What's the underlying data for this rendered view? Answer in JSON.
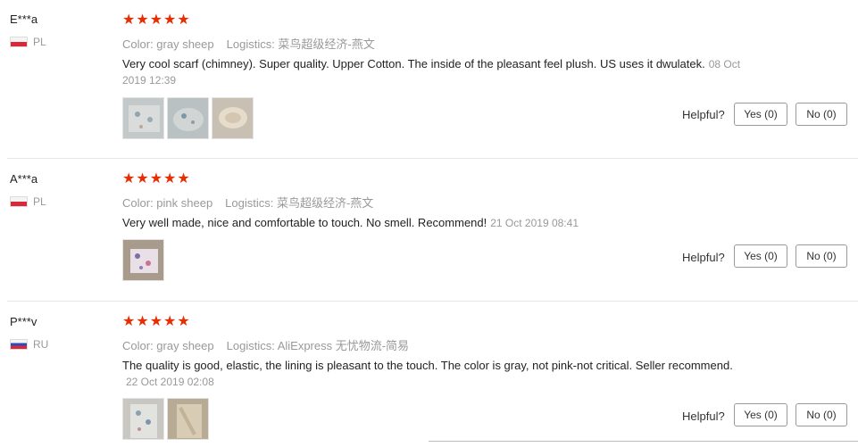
{
  "star_glyph": "★",
  "helpful_label": "Helpful?",
  "reviews": [
    {
      "user": "E***a",
      "country": "PL",
      "color": "Color: gray sheep",
      "logistics": "Logistics: 菜鸟超级经济-燕文",
      "text": "Very cool scarf (chimney). Super quality. Upper Cotton. The inside of the pleasant feel plush. US uses it dwulatek.",
      "date": "08 Oct 2019 12:39",
      "yes": "Yes (0)",
      "no": "No (0)"
    },
    {
      "user": "A***a",
      "country": "PL",
      "color": "Color: pink sheep",
      "logistics": "Logistics: 菜鸟超级经济-燕文",
      "text": "Very well made, nice and comfortable to touch. No smell. Recommend!",
      "date": "21 Oct 2019 08:41",
      "yes": "Yes (0)",
      "no": "No (0)"
    },
    {
      "user": "P***v",
      "country": "RU",
      "color": "Color: gray sheep",
      "logistics": "Logistics: AliExpress 无忧物流-简易",
      "text": "The quality is good, elastic, the lining is pleasant to the touch. The color is gray, not pink-not critical. Seller recommend.",
      "date": "22 Oct 2019 02:08",
      "yes": "Yes (0)",
      "no": "No (0)"
    }
  ]
}
